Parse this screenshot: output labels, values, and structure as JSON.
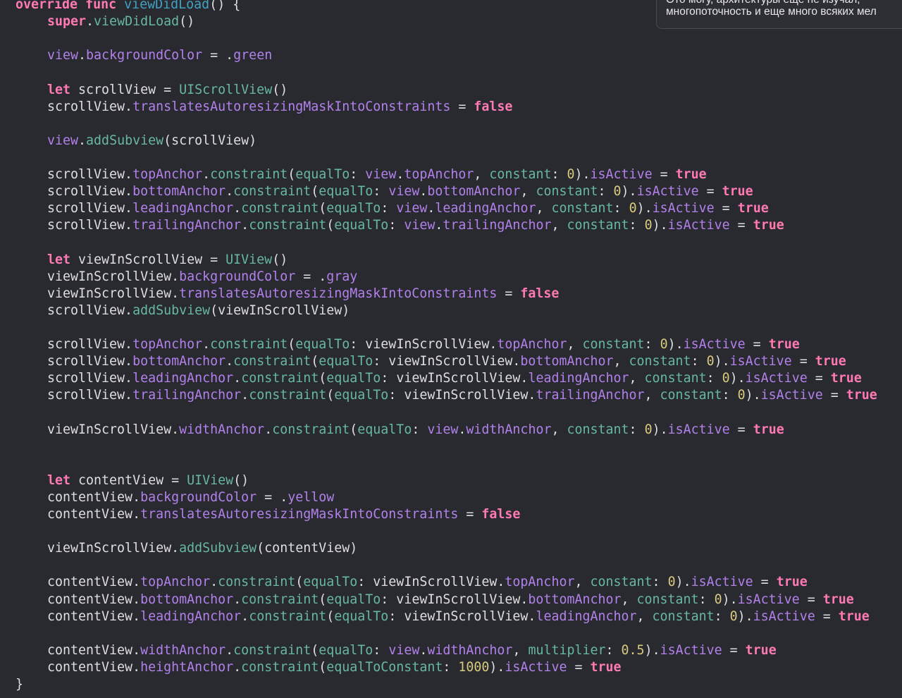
{
  "theme": {
    "background": "#292a30",
    "keyword": "#ff7ab2",
    "plain": "#dfdfe0",
    "property": "#b281eb",
    "method": "#67b7a4",
    "number": "#d9c97c",
    "function_name": "#41a1c0"
  },
  "tooltip": {
    "line1": "Ото могу, архитектуры еще не изучал,",
    "line2": "многопоточность и еще много всяких мел"
  },
  "code_lines": [
    {
      "indent": 0,
      "tokens": [
        [
          "kw",
          "override"
        ],
        [
          "plain",
          " "
        ],
        [
          "kw",
          "func"
        ],
        [
          "plain",
          " "
        ],
        [
          "fnname",
          "viewDidLoad"
        ],
        [
          "plain",
          "() {"
        ]
      ]
    },
    {
      "indent": 1,
      "tokens": [
        [
          "kw",
          "super"
        ],
        [
          "plain",
          "."
        ],
        [
          "fn",
          "viewDidLoad"
        ],
        [
          "plain",
          "()"
        ]
      ]
    },
    {
      "indent": 1,
      "tokens": []
    },
    {
      "indent": 1,
      "tokens": [
        [
          "prop",
          "view"
        ],
        [
          "plain",
          "."
        ],
        [
          "prop",
          "backgroundColor"
        ],
        [
          "plain",
          " = ."
        ],
        [
          "prop",
          "green"
        ]
      ]
    },
    {
      "indent": 1,
      "tokens": []
    },
    {
      "indent": 1,
      "tokens": [
        [
          "kw",
          "let"
        ],
        [
          "plain",
          " scrollView = "
        ],
        [
          "fn",
          "UIScrollView"
        ],
        [
          "plain",
          "()"
        ]
      ]
    },
    {
      "indent": 1,
      "tokens": [
        [
          "plain",
          "scrollView."
        ],
        [
          "prop",
          "translatesAutoresizingMaskIntoConstraints"
        ],
        [
          "plain",
          " = "
        ],
        [
          "kw",
          "false"
        ]
      ]
    },
    {
      "indent": 1,
      "tokens": []
    },
    {
      "indent": 1,
      "tokens": [
        [
          "prop",
          "view"
        ],
        [
          "plain",
          "."
        ],
        [
          "fn",
          "addSubview"
        ],
        [
          "plain",
          "(scrollView)"
        ]
      ]
    },
    {
      "indent": 1,
      "tokens": []
    },
    {
      "indent": 1,
      "tokens": [
        [
          "plain",
          "scrollView."
        ],
        [
          "prop",
          "topAnchor"
        ],
        [
          "plain",
          "."
        ],
        [
          "fn",
          "constraint"
        ],
        [
          "plain",
          "("
        ],
        [
          "fn",
          "equalTo"
        ],
        [
          "plain",
          ": "
        ],
        [
          "prop",
          "view"
        ],
        [
          "plain",
          "."
        ],
        [
          "prop",
          "topAnchor"
        ],
        [
          "plain",
          ", "
        ],
        [
          "fn",
          "constant"
        ],
        [
          "plain",
          ": "
        ],
        [
          "num",
          "0"
        ],
        [
          "plain",
          ")."
        ],
        [
          "prop",
          "isActive"
        ],
        [
          "plain",
          " = "
        ],
        [
          "kw",
          "true"
        ]
      ]
    },
    {
      "indent": 1,
      "tokens": [
        [
          "plain",
          "scrollView."
        ],
        [
          "prop",
          "bottomAnchor"
        ],
        [
          "plain",
          "."
        ],
        [
          "fn",
          "constraint"
        ],
        [
          "plain",
          "("
        ],
        [
          "fn",
          "equalTo"
        ],
        [
          "plain",
          ": "
        ],
        [
          "prop",
          "view"
        ],
        [
          "plain",
          "."
        ],
        [
          "prop",
          "bottomAnchor"
        ],
        [
          "plain",
          ", "
        ],
        [
          "fn",
          "constant"
        ],
        [
          "plain",
          ": "
        ],
        [
          "num",
          "0"
        ],
        [
          "plain",
          ")."
        ],
        [
          "prop",
          "isActive"
        ],
        [
          "plain",
          " = "
        ],
        [
          "kw",
          "true"
        ]
      ]
    },
    {
      "indent": 1,
      "tokens": [
        [
          "plain",
          "scrollView."
        ],
        [
          "prop",
          "leadingAnchor"
        ],
        [
          "plain",
          "."
        ],
        [
          "fn",
          "constraint"
        ],
        [
          "plain",
          "("
        ],
        [
          "fn",
          "equalTo"
        ],
        [
          "plain",
          ": "
        ],
        [
          "prop",
          "view"
        ],
        [
          "plain",
          "."
        ],
        [
          "prop",
          "leadingAnchor"
        ],
        [
          "plain",
          ", "
        ],
        [
          "fn",
          "constant"
        ],
        [
          "plain",
          ": "
        ],
        [
          "num",
          "0"
        ],
        [
          "plain",
          ")."
        ],
        [
          "prop",
          "isActive"
        ],
        [
          "plain",
          " = "
        ],
        [
          "kw",
          "true"
        ]
      ]
    },
    {
      "indent": 1,
      "tokens": [
        [
          "plain",
          "scrollView."
        ],
        [
          "prop",
          "trailingAnchor"
        ],
        [
          "plain",
          "."
        ],
        [
          "fn",
          "constraint"
        ],
        [
          "plain",
          "("
        ],
        [
          "fn",
          "equalTo"
        ],
        [
          "plain",
          ": "
        ],
        [
          "prop",
          "view"
        ],
        [
          "plain",
          "."
        ],
        [
          "prop",
          "trailingAnchor"
        ],
        [
          "plain",
          ", "
        ],
        [
          "fn",
          "constant"
        ],
        [
          "plain",
          ": "
        ],
        [
          "num",
          "0"
        ],
        [
          "plain",
          ")."
        ],
        [
          "prop",
          "isActive"
        ],
        [
          "plain",
          " = "
        ],
        [
          "kw",
          "true"
        ]
      ]
    },
    {
      "indent": 1,
      "tokens": []
    },
    {
      "indent": 1,
      "tokens": [
        [
          "kw",
          "let"
        ],
        [
          "plain",
          " viewInScrollView = "
        ],
        [
          "fn",
          "UIView"
        ],
        [
          "plain",
          "()"
        ]
      ]
    },
    {
      "indent": 1,
      "tokens": [
        [
          "plain",
          "viewInScrollView."
        ],
        [
          "prop",
          "backgroundColor"
        ],
        [
          "plain",
          " = ."
        ],
        [
          "prop",
          "gray"
        ]
      ]
    },
    {
      "indent": 1,
      "tokens": [
        [
          "plain",
          "viewInScrollView."
        ],
        [
          "prop",
          "translatesAutoresizingMaskIntoConstraints"
        ],
        [
          "plain",
          " = "
        ],
        [
          "kw",
          "false"
        ]
      ]
    },
    {
      "indent": 1,
      "tokens": [
        [
          "plain",
          "scrollView."
        ],
        [
          "fn",
          "addSubview"
        ],
        [
          "plain",
          "(viewInScrollView)"
        ]
      ]
    },
    {
      "indent": 1,
      "tokens": []
    },
    {
      "indent": 1,
      "tokens": [
        [
          "plain",
          "scrollView."
        ],
        [
          "prop",
          "topAnchor"
        ],
        [
          "plain",
          "."
        ],
        [
          "fn",
          "constraint"
        ],
        [
          "plain",
          "("
        ],
        [
          "fn",
          "equalTo"
        ],
        [
          "plain",
          ": viewInScrollView."
        ],
        [
          "prop",
          "topAnchor"
        ],
        [
          "plain",
          ", "
        ],
        [
          "fn",
          "constant"
        ],
        [
          "plain",
          ": "
        ],
        [
          "num",
          "0"
        ],
        [
          "plain",
          ")."
        ],
        [
          "prop",
          "isActive"
        ],
        [
          "plain",
          " = "
        ],
        [
          "kw",
          "true"
        ]
      ]
    },
    {
      "indent": 1,
      "tokens": [
        [
          "plain",
          "scrollView."
        ],
        [
          "prop",
          "bottomAnchor"
        ],
        [
          "plain",
          "."
        ],
        [
          "fn",
          "constraint"
        ],
        [
          "plain",
          "("
        ],
        [
          "fn",
          "equalTo"
        ],
        [
          "plain",
          ": viewInScrollView."
        ],
        [
          "prop",
          "bottomAnchor"
        ],
        [
          "plain",
          ", "
        ],
        [
          "fn",
          "constant"
        ],
        [
          "plain",
          ": "
        ],
        [
          "num",
          "0"
        ],
        [
          "plain",
          ")."
        ],
        [
          "prop",
          "isActive"
        ],
        [
          "plain",
          " = "
        ],
        [
          "kw",
          "true"
        ]
      ]
    },
    {
      "indent": 1,
      "tokens": [
        [
          "plain",
          "scrollView."
        ],
        [
          "prop",
          "leadingAnchor"
        ],
        [
          "plain",
          "."
        ],
        [
          "fn",
          "constraint"
        ],
        [
          "plain",
          "("
        ],
        [
          "fn",
          "equalTo"
        ],
        [
          "plain",
          ": viewInScrollView."
        ],
        [
          "prop",
          "leadingAnchor"
        ],
        [
          "plain",
          ", "
        ],
        [
          "fn",
          "constant"
        ],
        [
          "plain",
          ": "
        ],
        [
          "num",
          "0"
        ],
        [
          "plain",
          ")."
        ],
        [
          "prop",
          "isActive"
        ],
        [
          "plain",
          " = "
        ],
        [
          "kw",
          "true"
        ]
      ]
    },
    {
      "indent": 1,
      "tokens": [
        [
          "plain",
          "scrollView."
        ],
        [
          "prop",
          "trailingAnchor"
        ],
        [
          "plain",
          "."
        ],
        [
          "fn",
          "constraint"
        ],
        [
          "plain",
          "("
        ],
        [
          "fn",
          "equalTo"
        ],
        [
          "plain",
          ": viewInScrollView."
        ],
        [
          "prop",
          "trailingAnchor"
        ],
        [
          "plain",
          ", "
        ],
        [
          "fn",
          "constant"
        ],
        [
          "plain",
          ": "
        ],
        [
          "num",
          "0"
        ],
        [
          "plain",
          ")."
        ],
        [
          "prop",
          "isActive"
        ],
        [
          "plain",
          " = "
        ],
        [
          "kw",
          "true"
        ]
      ]
    },
    {
      "indent": 1,
      "tokens": []
    },
    {
      "indent": 1,
      "tokens": [
        [
          "plain",
          "viewInScrollView."
        ],
        [
          "prop",
          "widthAnchor"
        ],
        [
          "plain",
          "."
        ],
        [
          "fn",
          "constraint"
        ],
        [
          "plain",
          "("
        ],
        [
          "fn",
          "equalTo"
        ],
        [
          "plain",
          ": "
        ],
        [
          "prop",
          "view"
        ],
        [
          "plain",
          "."
        ],
        [
          "prop",
          "widthAnchor"
        ],
        [
          "plain",
          ", "
        ],
        [
          "fn",
          "constant"
        ],
        [
          "plain",
          ": "
        ],
        [
          "num",
          "0"
        ],
        [
          "plain",
          ")."
        ],
        [
          "prop",
          "isActive"
        ],
        [
          "plain",
          " = "
        ],
        [
          "kw",
          "true"
        ]
      ]
    },
    {
      "indent": 1,
      "tokens": []
    },
    {
      "indent": 1,
      "tokens": []
    },
    {
      "indent": 1,
      "tokens": [
        [
          "kw",
          "let"
        ],
        [
          "plain",
          " contentView = "
        ],
        [
          "fn",
          "UIView"
        ],
        [
          "plain",
          "()"
        ]
      ]
    },
    {
      "indent": 1,
      "tokens": [
        [
          "plain",
          "contentView."
        ],
        [
          "prop",
          "backgroundColor"
        ],
        [
          "plain",
          " = ."
        ],
        [
          "prop",
          "yellow"
        ]
      ]
    },
    {
      "indent": 1,
      "tokens": [
        [
          "plain",
          "contentView."
        ],
        [
          "prop",
          "translatesAutoresizingMaskIntoConstraints"
        ],
        [
          "plain",
          " = "
        ],
        [
          "kw",
          "false"
        ]
      ]
    },
    {
      "indent": 1,
      "tokens": []
    },
    {
      "indent": 1,
      "tokens": [
        [
          "plain",
          "viewInScrollView."
        ],
        [
          "fn",
          "addSubview"
        ],
        [
          "plain",
          "(contentView)"
        ]
      ]
    },
    {
      "indent": 1,
      "tokens": []
    },
    {
      "indent": 1,
      "tokens": [
        [
          "plain",
          "contentView."
        ],
        [
          "prop",
          "topAnchor"
        ],
        [
          "plain",
          "."
        ],
        [
          "fn",
          "constraint"
        ],
        [
          "plain",
          "("
        ],
        [
          "fn",
          "equalTo"
        ],
        [
          "plain",
          ": viewInScrollView."
        ],
        [
          "prop",
          "topAnchor"
        ],
        [
          "plain",
          ", "
        ],
        [
          "fn",
          "constant"
        ],
        [
          "plain",
          ": "
        ],
        [
          "num",
          "0"
        ],
        [
          "plain",
          ")."
        ],
        [
          "prop",
          "isActive"
        ],
        [
          "plain",
          " = "
        ],
        [
          "kw",
          "true"
        ]
      ]
    },
    {
      "indent": 1,
      "tokens": [
        [
          "plain",
          "contentView."
        ],
        [
          "prop",
          "bottomAnchor"
        ],
        [
          "plain",
          "."
        ],
        [
          "fn",
          "constraint"
        ],
        [
          "plain",
          "("
        ],
        [
          "fn",
          "equalTo"
        ],
        [
          "plain",
          ": viewInScrollView."
        ],
        [
          "prop",
          "bottomAnchor"
        ],
        [
          "plain",
          ", "
        ],
        [
          "fn",
          "constant"
        ],
        [
          "plain",
          ": "
        ],
        [
          "num",
          "0"
        ],
        [
          "plain",
          ")."
        ],
        [
          "prop",
          "isActive"
        ],
        [
          "plain",
          " = "
        ],
        [
          "kw",
          "true"
        ]
      ]
    },
    {
      "indent": 1,
      "tokens": [
        [
          "plain",
          "contentView."
        ],
        [
          "prop",
          "leadingAnchor"
        ],
        [
          "plain",
          "."
        ],
        [
          "fn",
          "constraint"
        ],
        [
          "plain",
          "("
        ],
        [
          "fn",
          "equalTo"
        ],
        [
          "plain",
          ": viewInScrollView."
        ],
        [
          "prop",
          "leadingAnchor"
        ],
        [
          "plain",
          ", "
        ],
        [
          "fn",
          "constant"
        ],
        [
          "plain",
          ": "
        ],
        [
          "num",
          "0"
        ],
        [
          "plain",
          ")."
        ],
        [
          "prop",
          "isActive"
        ],
        [
          "plain",
          " = "
        ],
        [
          "kw",
          "true"
        ]
      ]
    },
    {
      "indent": 1,
      "tokens": []
    },
    {
      "indent": 1,
      "tokens": [
        [
          "plain",
          "contentView."
        ],
        [
          "prop",
          "widthAnchor"
        ],
        [
          "plain",
          "."
        ],
        [
          "fn",
          "constraint"
        ],
        [
          "plain",
          "("
        ],
        [
          "fn",
          "equalTo"
        ],
        [
          "plain",
          ": "
        ],
        [
          "prop",
          "view"
        ],
        [
          "plain",
          "."
        ],
        [
          "prop",
          "widthAnchor"
        ],
        [
          "plain",
          ", "
        ],
        [
          "fn",
          "multiplier"
        ],
        [
          "plain",
          ": "
        ],
        [
          "num",
          "0.5"
        ],
        [
          "plain",
          ")."
        ],
        [
          "prop",
          "isActive"
        ],
        [
          "plain",
          " = "
        ],
        [
          "kw",
          "true"
        ]
      ]
    },
    {
      "indent": 1,
      "tokens": [
        [
          "plain",
          "contentView."
        ],
        [
          "prop",
          "heightAnchor"
        ],
        [
          "plain",
          "."
        ],
        [
          "fn",
          "constraint"
        ],
        [
          "plain",
          "("
        ],
        [
          "fn",
          "equalToConstant"
        ],
        [
          "plain",
          ": "
        ],
        [
          "num",
          "1000"
        ],
        [
          "plain",
          ")."
        ],
        [
          "prop",
          "isActive"
        ],
        [
          "plain",
          " = "
        ],
        [
          "kw",
          "true"
        ]
      ]
    },
    {
      "indent": 0,
      "tokens": [
        [
          "plain",
          "}"
        ]
      ]
    }
  ]
}
